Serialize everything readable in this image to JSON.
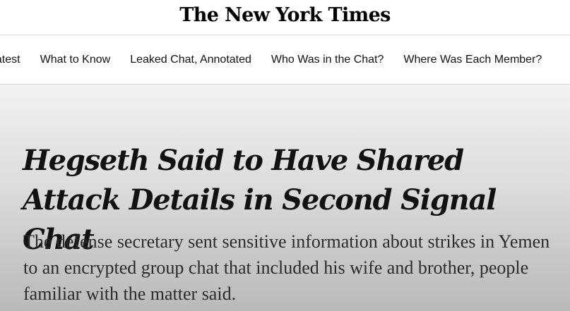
{
  "masthead": {
    "logo_text": "The New York Times"
  },
  "nav": {
    "items": [
      {
        "label": "Latest"
      },
      {
        "label": "What to Know"
      },
      {
        "label": "Leaked Chat, Annotated"
      },
      {
        "label": "Who Was in the Chat?"
      },
      {
        "label": "Where Was Each Member?"
      }
    ]
  },
  "article": {
    "headline": "Hegseth Said to Have Shared Attack Details in Second Signal Chat",
    "summary": "The defense secretary sent sensitive information about strikes in Yemen to an encrypted group chat that included his wife and brother, people familiar with the matter said."
  },
  "colors": {
    "text": "#121212",
    "summary_text": "#2b2b2b",
    "divider": "#dfdfdf"
  }
}
